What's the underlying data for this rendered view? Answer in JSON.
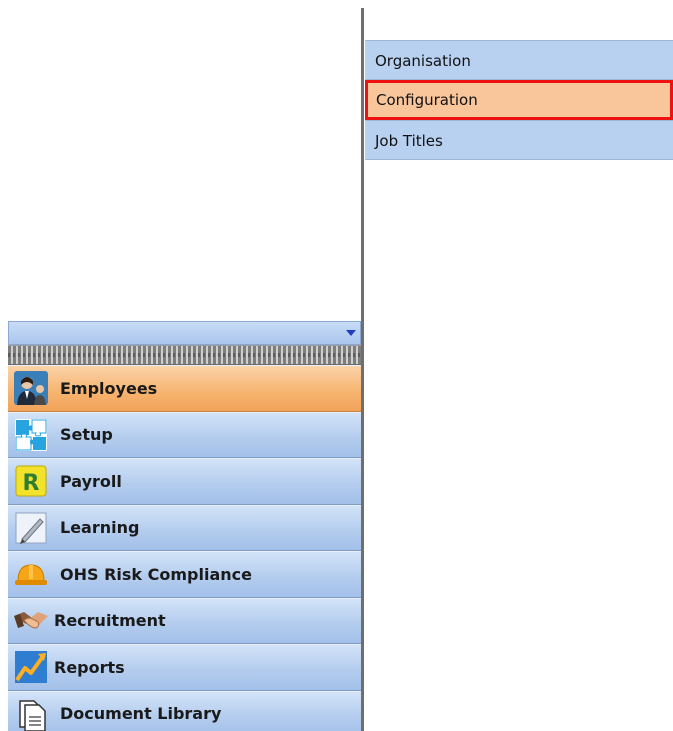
{
  "right_pane": {
    "items": [
      {
        "label": "Organisation",
        "selected": false
      },
      {
        "label": "Configuration",
        "selected": true
      },
      {
        "label": "Job Titles",
        "selected": false
      }
    ]
  },
  "nav": {
    "collapse_icon": "chevron-down-icon",
    "items": [
      {
        "label": "Employees",
        "icon": "employee-icon",
        "active": true
      },
      {
        "label": "Setup",
        "icon": "setup-icon",
        "active": false
      },
      {
        "label": "Payroll",
        "icon": "payroll-icon",
        "active": false
      },
      {
        "label": "Learning",
        "icon": "learning-icon",
        "active": false
      },
      {
        "label": "OHS Risk Compliance",
        "icon": "hard-hat-icon",
        "active": false
      },
      {
        "label": "Recruitment",
        "icon": "handshake-icon",
        "active": false
      },
      {
        "label": "Reports",
        "icon": "chart-icon",
        "active": false
      },
      {
        "label": "Document Library",
        "icon": "document-icon",
        "active": false
      }
    ]
  },
  "colors": {
    "selected_bg": "#f9c59a",
    "selected_border": "#ee1111",
    "item_bg": "#b8d1f1",
    "active_nav": "#f6b36e"
  }
}
